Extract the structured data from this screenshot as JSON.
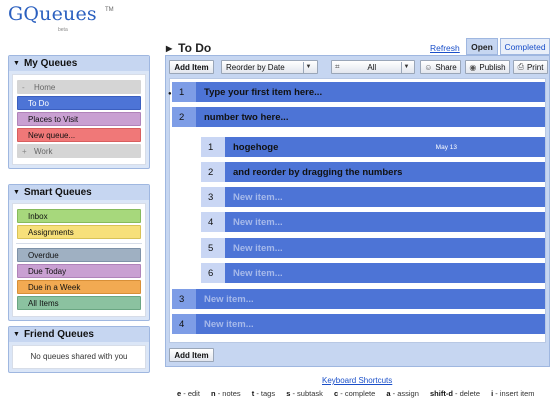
{
  "app": {
    "logo_text": "GQueues",
    "logo_tm": "TM",
    "logo_beta": "beta"
  },
  "sidebar": {
    "my_queues": {
      "title": "My Queues",
      "items": [
        {
          "label": "Home",
          "expander": "-"
        },
        {
          "label": "To Do"
        },
        {
          "label": "Places to Visit"
        },
        {
          "label": "New queue..."
        },
        {
          "label": "Work",
          "expander": "+"
        }
      ]
    },
    "smart_queues": {
      "title": "Smart Queues",
      "items": [
        {
          "label": "Inbox"
        },
        {
          "label": "Assignments"
        },
        {
          "label": "Overdue"
        },
        {
          "label": "Due Today"
        },
        {
          "label": "Due in a Week"
        },
        {
          "label": "All Items"
        }
      ]
    },
    "friend_queues": {
      "title": "Friend Queues",
      "empty_text": "No queues shared with you"
    }
  },
  "header": {
    "title": "To Do",
    "refresh": "Refresh",
    "tabs": {
      "open": "Open",
      "completed": "Completed"
    }
  },
  "toolbar": {
    "add_item": "Add Item",
    "reorder": "Reorder by Date",
    "filter": "All",
    "share": "Share",
    "publish": "Publish",
    "print": "Print"
  },
  "tasks": [
    {
      "num": "1",
      "text": "Type your first item here..."
    },
    {
      "num": "2",
      "text": "number two here..."
    },
    {
      "num": "1",
      "text": "hogehoge",
      "date": "May 13"
    },
    {
      "num": "2",
      "text": "and reorder by dragging the numbers"
    },
    {
      "num": "3",
      "text": "New item..."
    },
    {
      "num": "4",
      "text": "New item..."
    },
    {
      "num": "5",
      "text": "New item..."
    },
    {
      "num": "6",
      "text": "New item..."
    },
    {
      "num": "3",
      "text": "New item..."
    },
    {
      "num": "4",
      "text": "New item..."
    }
  ],
  "footer": {
    "keyboard_shortcuts": "Keyboard Shortcuts",
    "shortcuts": [
      {
        "key": "e",
        "action": "edit"
      },
      {
        "key": "n",
        "action": "notes"
      },
      {
        "key": "t",
        "action": "tags"
      },
      {
        "key": "s",
        "action": "subtask"
      },
      {
        "key": "c",
        "action": "complete"
      },
      {
        "key": "a",
        "action": "assign"
      },
      {
        "key": "shift-d",
        "action": "delete"
      },
      {
        "key": "i",
        "action": "insert item"
      }
    ]
  },
  "colors": {
    "accent": "#4d74d6",
    "link": "#1a4fc9",
    "panel_header": "#c6d6f1"
  }
}
